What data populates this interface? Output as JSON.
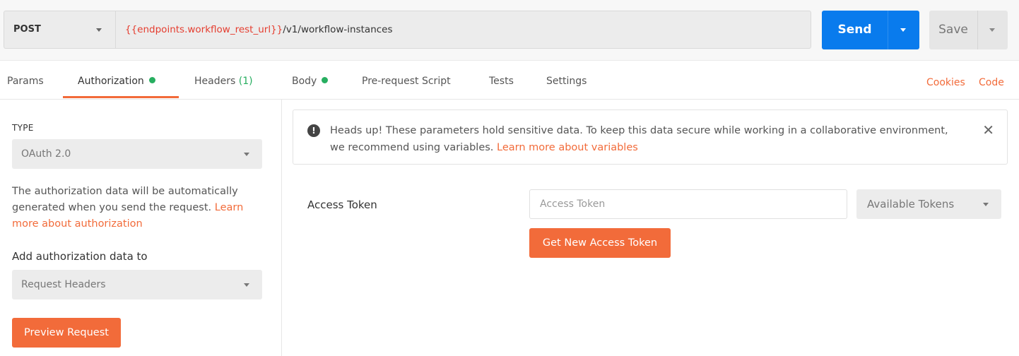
{
  "request": {
    "method": "POST",
    "url_variable": "{{endpoints.workflow_rest_url}}",
    "url_path": "/v1/workflow-instances",
    "send_label": "Send",
    "save_label": "Save"
  },
  "tabs": [
    {
      "label": "Params"
    },
    {
      "label": "Authorization",
      "dot": true,
      "active": true
    },
    {
      "label": "Headers",
      "count": "(1)"
    },
    {
      "label": "Body",
      "dot": true
    },
    {
      "label": "Pre-request Script"
    },
    {
      "label": "Tests"
    },
    {
      "label": "Settings"
    }
  ],
  "tab_links": {
    "cookies": "Cookies",
    "code": "Code"
  },
  "auth": {
    "type_label": "TYPE",
    "type_value": "OAuth 2.0",
    "help_text": "The authorization data will be automatically generated when you send the request.",
    "help_link": "Learn more about authorization",
    "add_label": "Add authorization data to",
    "add_value": "Request Headers",
    "preview_label": "Preview Request"
  },
  "alert": {
    "text": "Heads up! These parameters hold sensitive data. To keep this data secure while working in a collaborative environment, we recommend using variables.",
    "link": "Learn more about variables",
    "icon": "!",
    "close": "✕"
  },
  "token": {
    "label": "Access Token",
    "placeholder": "Access Token",
    "available_label": "Available Tokens",
    "get_new_label": "Get New Access Token"
  },
  "colors": {
    "accent": "#f26b3a",
    "send": "#097bed",
    "url_variable": "#e53d2f",
    "status_dot": "#27ae60"
  }
}
